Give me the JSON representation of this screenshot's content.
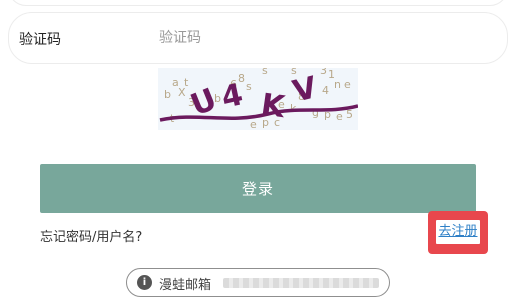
{
  "captcha": {
    "label": "验证码",
    "placeholder": "验证码",
    "value": "",
    "image_code": "U4KV",
    "image_glyphs": [
      "U",
      "4",
      "K",
      "V"
    ],
    "noise_chars": "bat6s3Xs1n4eb3kegpe5t8e8gpc"
  },
  "login": {
    "button_label": "登录",
    "color": "#78a79b"
  },
  "links": {
    "forgot": "忘记密码/用户名?",
    "register": "去注册"
  },
  "notice": {
    "icon": "info-icon",
    "text_visible": "漫蛙邮箱"
  },
  "colors": {
    "highlight": "#e8474d",
    "link": "#2f80c7",
    "captcha_curve": "#6b1a5e"
  }
}
